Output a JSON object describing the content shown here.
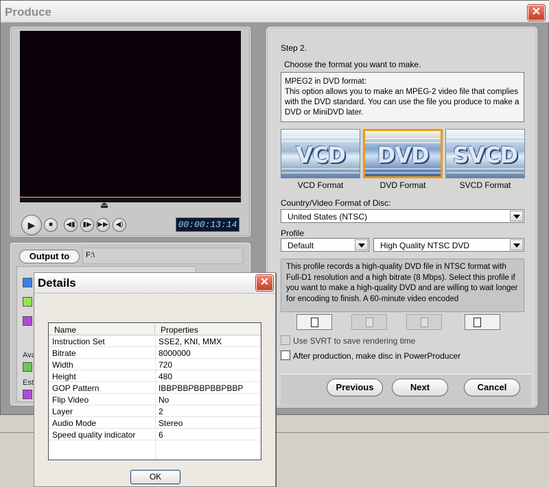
{
  "window": {
    "title": "Produce",
    "close_glyph": "✕"
  },
  "player": {
    "scrub_glyph": "⏏",
    "controls": {
      "play": "▶",
      "stop": "■",
      "prev_frame": "◀▮",
      "next_frame": "▮▶",
      "fast_forward": "▶▶",
      "volume": "◀)"
    },
    "timecode": "00:00:13:14"
  },
  "output": {
    "button_label": "Output to",
    "path": "F:\\",
    "side_labels": [
      "Ava",
      "Est"
    ],
    "swatch_colors": [
      "#3c7ff0",
      "#9be24a",
      "#b04ad8",
      "#6ac850",
      "#b04ad8"
    ]
  },
  "wizard": {
    "step": "Step 2.",
    "instruction": "Choose the format you want to make.",
    "description": {
      "title": "MPEG2 in DVD format:",
      "body": "This option allows you to make an MPEG-2 video file that complies with the DVD standard. You can use the file you produce to make a DVD or MiniDVD later."
    },
    "formats": [
      {
        "logo": "VCD",
        "label": "VCD Format",
        "selected": false
      },
      {
        "logo": "DVD",
        "label": "DVD Format",
        "selected": true
      },
      {
        "logo": "SVCD",
        "label": "SVCD Format",
        "selected": false
      }
    ],
    "country_label": "Country/Video Format of Disc:",
    "country_value": "United States (NTSC)",
    "profile_label": "Profile",
    "profile_set_value": "Default",
    "profile_value": "High Quality NTSC DVD",
    "profile_description": "This profile records a high-quality DVD file in NTSC format with Full-D1 resolution and a high bitrate (8 Mbps). Select this profile if you want to make a high-quality DVD and are willing to wait longer for encoding to finish. A 60-minute video encoded",
    "toolbar_icons": [
      "new-profile-icon",
      "edit-profile-icon",
      "delete-profile-icon",
      "profile-details-icon"
    ],
    "svrt_label": "Use SVRT to save rendering time",
    "after_production_label": "After production, make disc in PowerProducer",
    "buttons": {
      "previous": "Previous",
      "next": "Next",
      "cancel": "Cancel"
    }
  },
  "details_dialog": {
    "title": "Details",
    "close_glyph": "✕",
    "columns": [
      "Name",
      "Properties"
    ],
    "rows": [
      {
        "name": "Instruction Set",
        "value": "SSE2, KNI, MMX"
      },
      {
        "name": "Bitrate",
        "value": "8000000"
      },
      {
        "name": "Width",
        "value": "720"
      },
      {
        "name": "Height",
        "value": "480"
      },
      {
        "name": "GOP Pattern",
        "value": "IBBPBBPBBPBBPBBP"
      },
      {
        "name": "Flip Video",
        "value": "No"
      },
      {
        "name": "Layer",
        "value": "2"
      },
      {
        "name": "Audio Mode",
        "value": "Stereo"
      },
      {
        "name": "Speed quality indicator",
        "value": "6"
      }
    ],
    "ok_label": "OK"
  }
}
